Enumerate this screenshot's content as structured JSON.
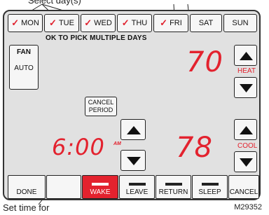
{
  "callout_top": "Select day(s)",
  "days": [
    {
      "label": "MON",
      "checked": true
    },
    {
      "label": "TUE",
      "checked": true
    },
    {
      "label": "WED",
      "checked": true
    },
    {
      "label": "THU",
      "checked": true
    },
    {
      "label": "FRI",
      "checked": true
    },
    {
      "label": "SAT",
      "checked": false
    },
    {
      "label": "SUN",
      "checked": false
    }
  ],
  "check_glyph": "✓",
  "message": "OK TO PICK MULTIPLE DAYS",
  "fan": {
    "label": "FAN",
    "mode": "AUTO"
  },
  "heat": {
    "setpoint": "70",
    "label": "HEAT"
  },
  "cool": {
    "setpoint": "78",
    "label": "COOL"
  },
  "cancel_period": "CANCEL PERIOD",
  "time": {
    "value": "6:00",
    "ampm": "AM"
  },
  "bottom": {
    "done": "DONE",
    "blank": "",
    "wake": "WAKE",
    "leave": "LEAVE",
    "return": "RETURN",
    "sleep": "SLEEP",
    "cancel": "CANCEL"
  },
  "callout_bottom": "Set time for",
  "model_code": "M29352",
  "colors": {
    "accent": "#e3222e",
    "panel": "#e1e1e1"
  }
}
